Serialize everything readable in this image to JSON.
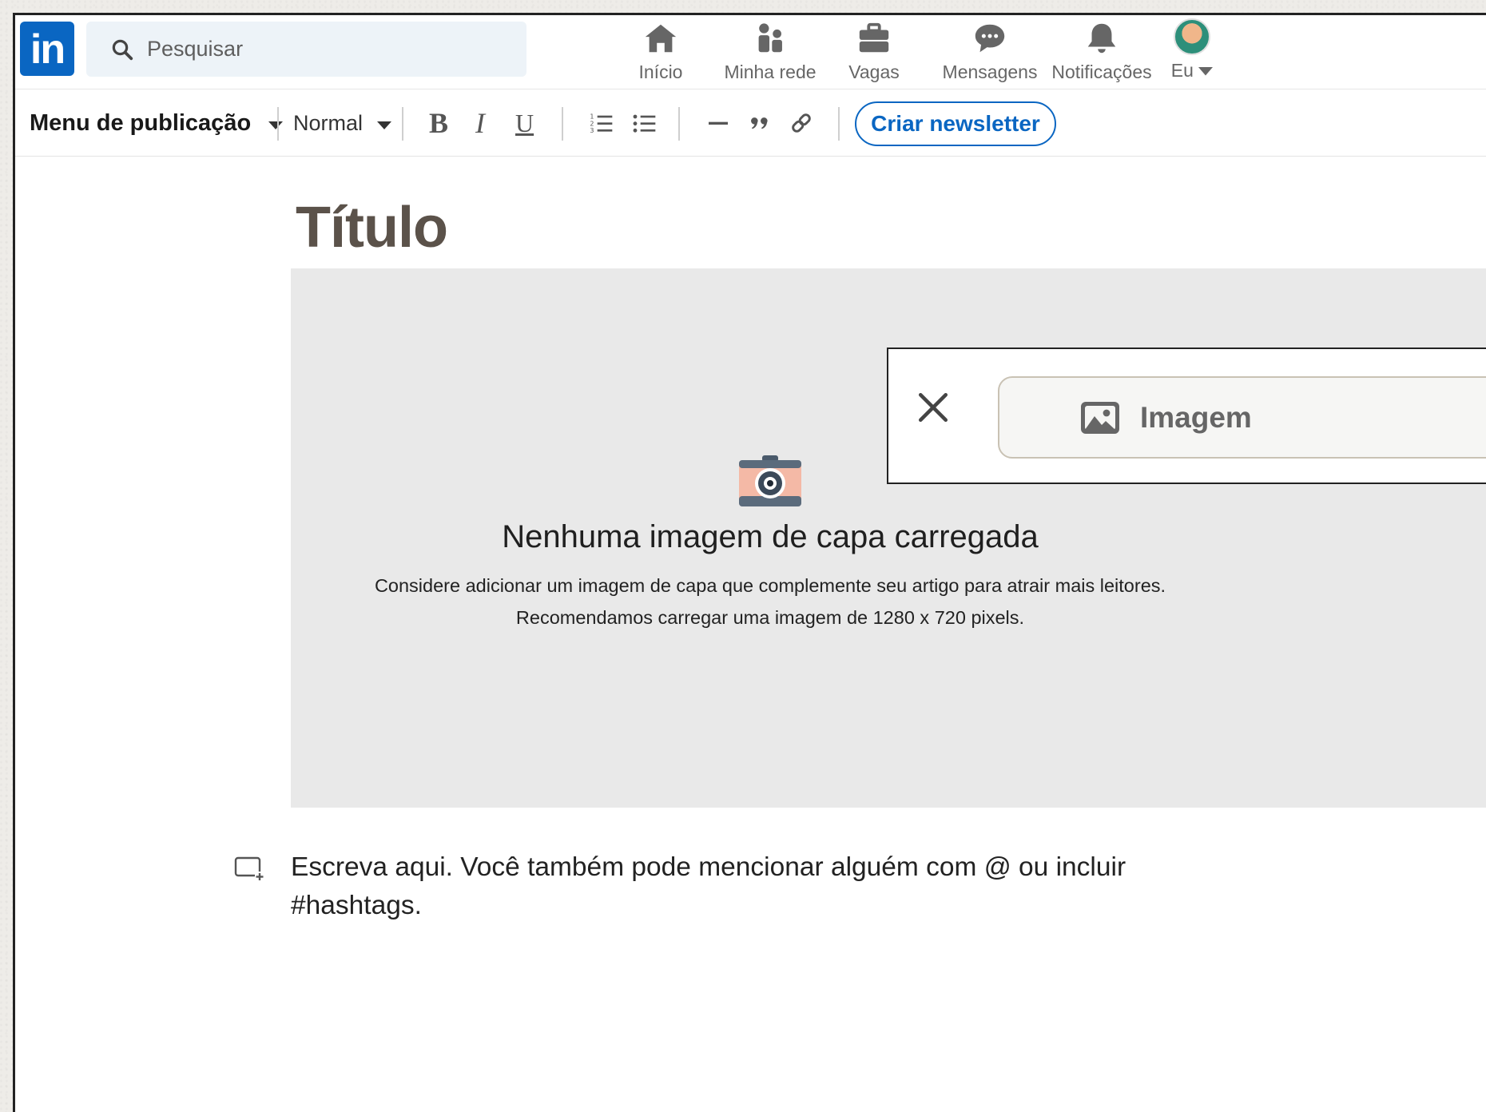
{
  "nav": {
    "search_placeholder": "Pesquisar",
    "items": [
      {
        "label": "Início",
        "icon": "home-icon"
      },
      {
        "label": "Minha rede",
        "icon": "network-icon"
      },
      {
        "label": "Vagas",
        "icon": "briefcase-icon"
      },
      {
        "label": "Mensagens",
        "icon": "messaging-icon"
      },
      {
        "label": "Notificações",
        "icon": "bell-icon"
      },
      {
        "label": "Eu",
        "icon": "avatar"
      }
    ]
  },
  "toolbar": {
    "publication_menu": "Menu de publicação",
    "text_style": "Normal",
    "bold": "B",
    "italic": "I",
    "underline": "U",
    "create_newsletter": "Criar newsletter"
  },
  "editor": {
    "title_placeholder": "Título",
    "cover": {
      "heading": "Nenhuma imagem de capa carregada",
      "line1": "Considere adicionar um imagem de capa que complemente seu artigo para atrair mais leitores.",
      "line2": "Recomendamos carregar uma imagem de 1280 x 720 pixels."
    },
    "image_button": "Imagem",
    "body_placeholder": "Escreva aqui. Você também pode mencionar alguém com @ ou incluir #hashtags."
  },
  "colors": {
    "brand_blue": "#0a66c2",
    "title_color": "#5b524a",
    "cover_bg": "#e9e9e9"
  }
}
